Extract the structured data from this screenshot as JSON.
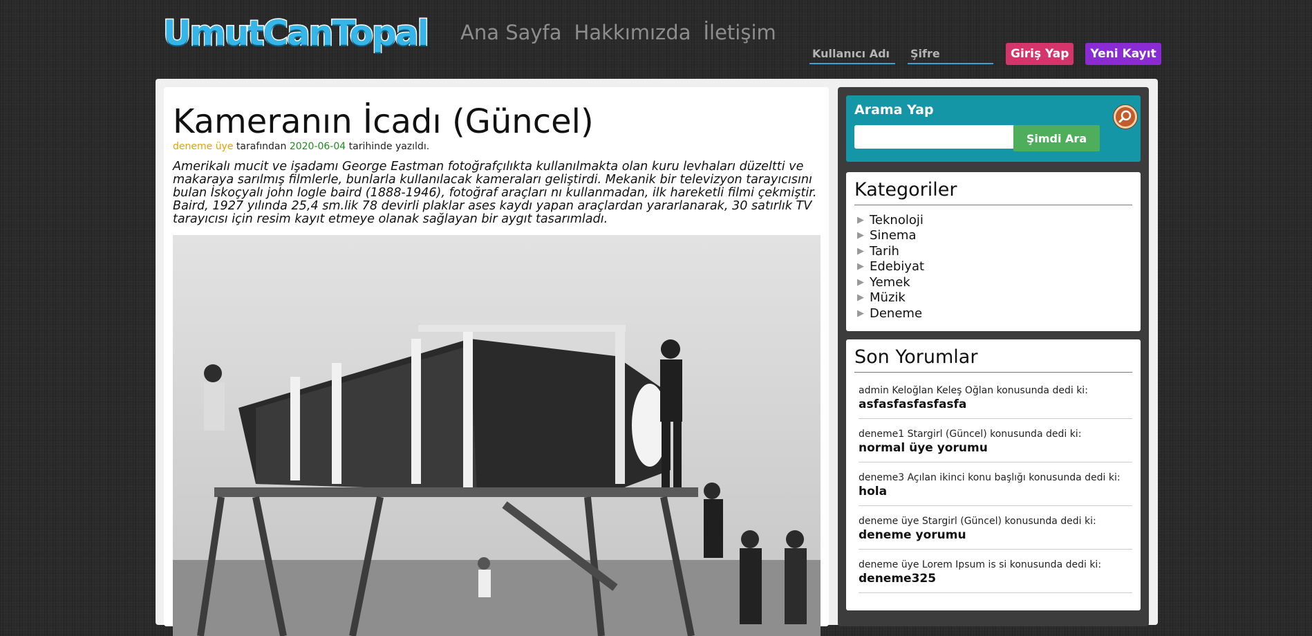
{
  "header": {
    "logo": "UmutCanTopal",
    "nav": [
      "Ana Sayfa",
      "Hakkımızda",
      "İletişim"
    ],
    "login": {
      "username_placeholder": "Kullanıcı Adı",
      "password_placeholder": "Şifre",
      "login_label": "Giriş Yap",
      "register_label": "Yeni Kayıt"
    }
  },
  "post": {
    "title": "Kameranın İcadı (Güncel)",
    "author": "deneme üye",
    "by_text": " tarafından ",
    "date": "2020-06-04",
    "written_text": " tarihinde yazıldı.",
    "body": "Amerikalı mucit ve işadamı George Eastman fotoğrafçılıkta kullanılmakta olan kuru levhaları düzeltti ve makaraya sarılmış filmlerle, bunlarla kullanılacak kameraları geliştirdi. Mekanik bir televizyon tarayıcısını bulan İskoçyalı john logle baird (1888-1946), fotoğraf araçları nı kullanmadan, ilk hareketli filmi çekmiştir. Baird, 1927 yılında 25,4 sm.lik 78 devirli plaklar ases kaydı yapan araçlardan yararlanarak, 30 satırlık TV tarayıcısı için resim kayıt etmeye olanak sağlayan bir aygıt tasarımladı."
  },
  "search": {
    "title": "Arama Yap",
    "button": "Şimdi Ara",
    "icon": "magnifier-icon"
  },
  "categories": {
    "title": "Kategoriler",
    "items": [
      "Teknoloji",
      "Sinema",
      "Tarih",
      "Edebiyat",
      "Yemek",
      "Müzik",
      "Deneme"
    ]
  },
  "comments": {
    "title": "Son Yorumlar",
    "items": [
      {
        "head": "admin Keloğlan Keleş Oğlan konusunda dedi ki:",
        "text": "asfasfasfasfasfa"
      },
      {
        "head": "deneme1 Stargirl (Güncel) konusunda dedi ki:",
        "text": "normal üye yorumu"
      },
      {
        "head": "deneme3 Açılan ikinci konu başlığı konusunda dedi ki:",
        "text": "hola"
      },
      {
        "head": "deneme üye Stargirl (Güncel) konusunda dedi ki:",
        "text": "deneme yorumu"
      },
      {
        "head": "deneme üye Lorem Ipsum is si konusunda dedi ki:",
        "text": "deneme325"
      }
    ]
  },
  "colors": {
    "accent_blue": "#35b5e8",
    "login_button": "#d6356b",
    "register_button": "#8a2bd4",
    "search_panel": "#1596a6",
    "search_button": "#4fae5c",
    "author": "#e4a400",
    "date": "#1a8f1a"
  }
}
